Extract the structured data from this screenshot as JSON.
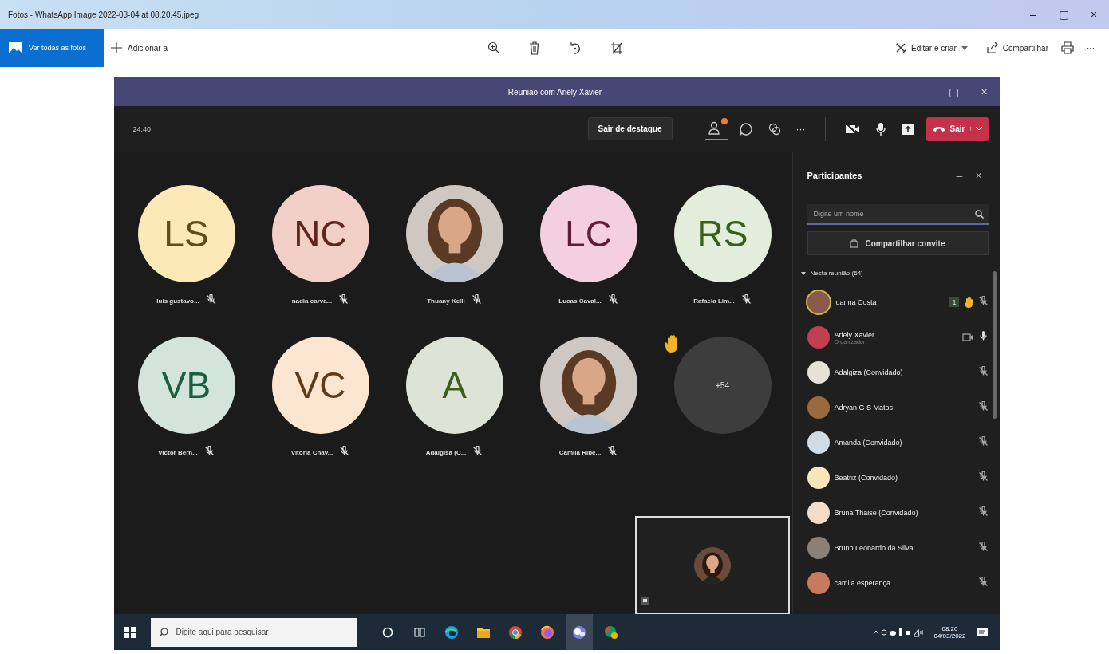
{
  "window": {
    "title": "Fotos - WhatsApp Image 2022-03-04 at 08.20.45.jpeg",
    "controls": [
      "–",
      "▢",
      "×"
    ]
  },
  "toolbar": {
    "view_all": "Ver todas as fotos",
    "add": "Adicionar a",
    "edit": "Editar e criar",
    "share": "Compartilhar",
    "more": "···"
  },
  "meeting": {
    "title": "Reunião com Ariely Xavier",
    "controls": [
      "–",
      "▢",
      "×"
    ],
    "timer": "24:40",
    "stop_spotlight": "Sair de destaque",
    "more": "···",
    "leave": "Sair",
    "tiles": [
      {
        "kind": "initials",
        "initials": "LS",
        "color": "#fbe9b8",
        "name": "luis gustavo...",
        "muted": true
      },
      {
        "kind": "initials",
        "initials": "NC",
        "color": "#f2d0c8",
        "name": "nadia carva...",
        "muted": true
      },
      {
        "name": "Thuany Kelli",
        "muted": true
      },
      {
        "kind": "initials",
        "initials": "LC",
        "color": "#f4cfe0",
        "name": "Lucas Caval...",
        "muted": true
      },
      {
        "kind": "initials",
        "initials": "RS",
        "color": "#e3eddc",
        "name": "Rafaela Lim...",
        "muted": true
      },
      {
        "kind": "initials",
        "initials": "VB",
        "color": "#d3e4dc",
        "name": "Victor Bern...",
        "muted": true
      },
      {
        "kind": "initials",
        "initials": "VC",
        "color": "#fce6d2",
        "name": "Vitória Chav...",
        "muted": true
      },
      {
        "kind": "initials",
        "initials": "A",
        "color": "#dde3d7",
        "name": "Adalgisa (C...",
        "muted": true
      },
      {
        "name": "Camila Ribe...",
        "muted": true
      },
      {
        "kind": "overflow",
        "label": "+54",
        "hand_raised": true
      }
    ],
    "panel": {
      "title": "Participantes",
      "search": {
        "placeholder": "Digite um nome"
      },
      "invite": "Compartilhar convite",
      "section": "Nesta reunião (64)",
      "expanded": true,
      "people": [
        {
          "name": "luanna Costa",
          "color": "#8a5a4a",
          "hand_raised": true,
          "hand_count": "1",
          "muted": true
        },
        {
          "name": "Ariely Xavier",
          "role": "Organizador",
          "color": "#c04050",
          "hand_raised": false,
          "muted": false
        },
        {
          "name": "Adalgiza (Convidado)",
          "color": "#e6e2d8",
          "hand_raised": false,
          "muted": true
        },
        {
          "name": "Adryan G S Matos",
          "color": "#9a6a3a",
          "hand_raised": false,
          "muted": true
        },
        {
          "name": "Amanda (Convidado)",
          "color": "#d0dce6",
          "hand_raised": false,
          "muted": true
        },
        {
          "name": "Beatriz (Convidado)",
          "color": "#f6e6b8",
          "hand_raised": false,
          "muted": true
        },
        {
          "name": "Bruna Thaise (Convidado)",
          "color": "#f4dcc8",
          "hand_raised": false,
          "muted": true
        },
        {
          "name": "Bruno Leonardo da Silva",
          "color": "#8a8078",
          "hand_raised": false,
          "muted": true
        },
        {
          "name": "camila esperança",
          "color": "#c87a60",
          "hand_raised": false,
          "muted": true
        }
      ]
    }
  },
  "taskbar": {
    "search": {
      "placeholder": "Digite aqui para pesquisar"
    },
    "time": "08:20",
    "date": "04/03/2022"
  }
}
